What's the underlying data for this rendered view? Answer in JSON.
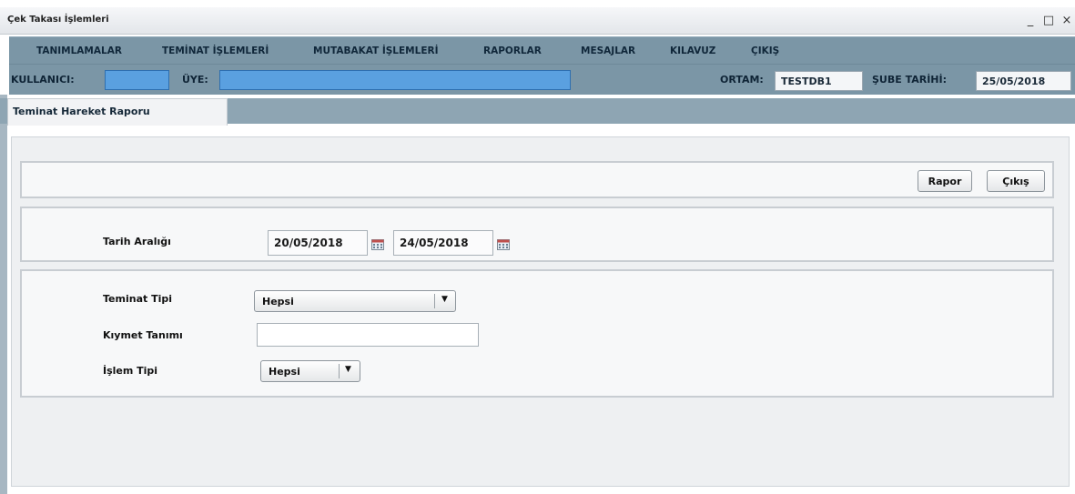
{
  "window": {
    "title": "Çek Takası İşlemleri",
    "controls": {
      "minimize": "_",
      "maximize": "□",
      "close": "×"
    }
  },
  "menu": {
    "items": [
      {
        "label": "TANIMLAMALAR"
      },
      {
        "label": "TEMİNAT İŞLEMLERİ"
      },
      {
        "label": "MUTABAKAT İŞLEMLERİ"
      },
      {
        "label": "RAPORLAR"
      },
      {
        "label": "MESAJLAR"
      },
      {
        "label": "KILAVUZ"
      },
      {
        "label": "ÇIKIŞ"
      }
    ]
  },
  "userbar": {
    "user_label": "KULLANICI:",
    "member_label": "ÜYE:",
    "env_label": "ORTAM:",
    "env_value": "TESTDB1",
    "branch_date_label": "ŞUBE TARİHİ:",
    "branch_date_value": "25/05/2018"
  },
  "tab": {
    "label": "Teminat Hareket Raporu"
  },
  "actions": {
    "report_label": "Rapor",
    "exit_label": "Çıkış"
  },
  "date_range": {
    "label": "Tarih Aralığı",
    "start": "20/05/2018",
    "end": "24/05/2018"
  },
  "filters": {
    "collateral_type_label": "Teminat Tipi",
    "collateral_type_value": "Hepsi",
    "security_def_label": "Kıymet Tanımı",
    "security_def_value": "",
    "transaction_type_label": "İşlem Tipi",
    "transaction_type_value": "Hepsi"
  },
  "colors": {
    "menubar": "#7b96a6",
    "blue_field": "#5aa0e0",
    "tabstrip": "#8ea5b3"
  },
  "icons": {
    "calendar": "calendar-icon",
    "dropdown": "chevron-down-icon"
  }
}
